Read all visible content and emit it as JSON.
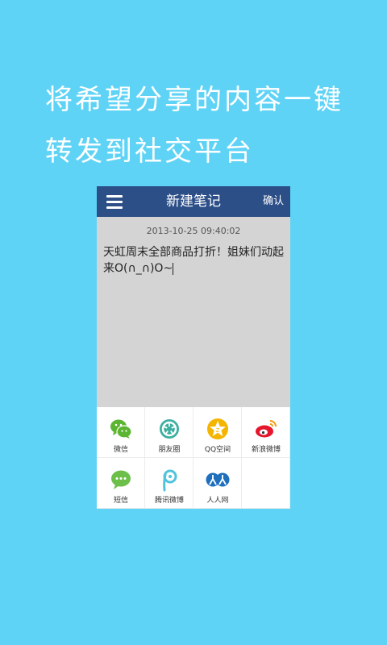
{
  "promo": {
    "line1": "将希望分享的内容一键",
    "line2": "转发到社交平台"
  },
  "app": {
    "title": "新建笔记",
    "confirm_label": "确认",
    "menu_icon": "menu-icon"
  },
  "note": {
    "timestamp": "2013-10-25 09:40:02",
    "text": "天虹周末全部商品打折！姐妹们动起来O(∩_∩)O~"
  },
  "share": {
    "items": [
      {
        "label": "微信",
        "icon": "wechat-icon",
        "color": "#5cb531"
      },
      {
        "label": "朋友圈",
        "icon": "moments-icon",
        "color": "#3bb0a0"
      },
      {
        "label": "QQ空间",
        "icon": "qzone-icon",
        "color": "#f4b400"
      },
      {
        "label": "新浪微博",
        "icon": "weibo-icon",
        "color": "#e6162d"
      },
      {
        "label": "短信",
        "icon": "sms-icon",
        "color": "#6cc04a"
      },
      {
        "label": "腾讯微博",
        "icon": "tencent-weibo-icon",
        "color": "#4fc3dc"
      },
      {
        "label": "人人网",
        "icon": "renren-icon",
        "color": "#1f6fbd"
      }
    ]
  },
  "colors": {
    "background": "#5fd3f6",
    "titlebar": "#2c4f88",
    "note_bg": "#d4d4d4"
  }
}
